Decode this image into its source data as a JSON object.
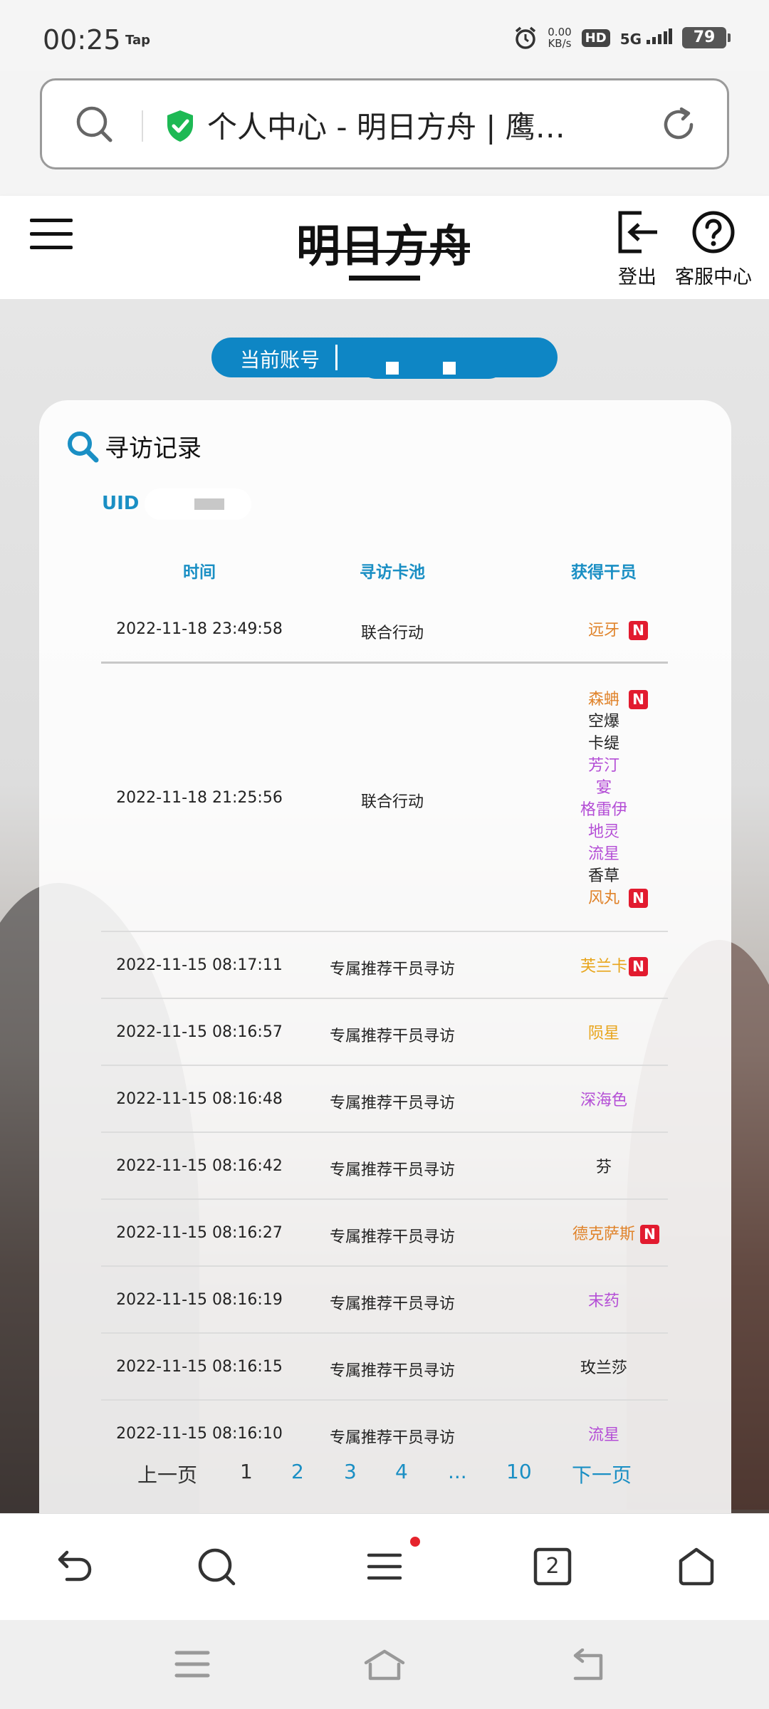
{
  "status_bar": {
    "time": "00:25",
    "app_indicator": "Tap",
    "net_speed_value": "0.00",
    "net_speed_unit": "KB/s",
    "hd": "HD",
    "signal": "5G",
    "battery": "79"
  },
  "address_bar": {
    "title": "个人中心 - 明日方舟 | 鹰…"
  },
  "header": {
    "logo_text": "明日方舟",
    "logout_label": "登出",
    "help_label": "客服中心"
  },
  "account": {
    "label": "当前账号"
  },
  "card": {
    "title": "寻访记录",
    "uid_label": "UID"
  },
  "table": {
    "headers": {
      "time": "时间",
      "pool": "寻访卡池",
      "operator": "获得干员"
    },
    "rows": [
      {
        "time": "2022-11-18 23:49:58",
        "pool": "联合行动",
        "ops": [
          {
            "name": "远牙",
            "color": "#e0832a",
            "new": true
          }
        ]
      },
      {
        "time": "2022-11-18 21:25:56",
        "pool": "联合行动",
        "ops": [
          {
            "name": "森蚺",
            "color": "#e0832a",
            "new": true
          },
          {
            "name": "空爆",
            "color": "#222222",
            "new": false
          },
          {
            "name": "卡缇",
            "color": "#222222",
            "new": false
          },
          {
            "name": "芳汀",
            "color": "#b44ed6",
            "new": false
          },
          {
            "name": "宴",
            "color": "#b44ed6",
            "new": false
          },
          {
            "name": "格雷伊",
            "color": "#b44ed6",
            "new": false
          },
          {
            "name": "地灵",
            "color": "#b44ed6",
            "new": false
          },
          {
            "name": "流星",
            "color": "#b44ed6",
            "new": false
          },
          {
            "name": "香草",
            "color": "#222222",
            "new": false
          },
          {
            "name": "风丸",
            "color": "#e0832a",
            "new": true
          }
        ]
      },
      {
        "time": "2022-11-15 08:17:11",
        "pool": "专属推荐干员寻访",
        "ops": [
          {
            "name": "芙兰卡",
            "color": "#e8a51c",
            "new": true
          }
        ]
      },
      {
        "time": "2022-11-15 08:16:57",
        "pool": "专属推荐干员寻访",
        "ops": [
          {
            "name": "陨星",
            "color": "#e8a51c",
            "new": false
          }
        ]
      },
      {
        "time": "2022-11-15 08:16:48",
        "pool": "专属推荐干员寻访",
        "ops": [
          {
            "name": "深海色",
            "color": "#b44ed6",
            "new": false
          }
        ]
      },
      {
        "time": "2022-11-15 08:16:42",
        "pool": "专属推荐干员寻访",
        "ops": [
          {
            "name": "芬",
            "color": "#222222",
            "new": false
          }
        ]
      },
      {
        "time": "2022-11-15 08:16:27",
        "pool": "专属推荐干员寻访",
        "ops": [
          {
            "name": "德克萨斯",
            "color": "#e0832a",
            "new": true
          }
        ]
      },
      {
        "time": "2022-11-15 08:16:19",
        "pool": "专属推荐干员寻访",
        "ops": [
          {
            "name": "末药",
            "color": "#b44ed6",
            "new": false
          }
        ]
      },
      {
        "time": "2022-11-15 08:16:15",
        "pool": "专属推荐干员寻访",
        "ops": [
          {
            "name": "玫兰莎",
            "color": "#222222",
            "new": false
          }
        ]
      },
      {
        "time": "2022-11-15 08:16:10",
        "pool": "专属推荐干员寻访",
        "ops": [
          {
            "name": "流星",
            "color": "#b44ed6",
            "new": false
          }
        ]
      }
    ],
    "new_badge": "N"
  },
  "pagination": {
    "prev": "上一页",
    "pages": [
      "1",
      "2",
      "3",
      "4",
      "...",
      "10"
    ],
    "current": "1",
    "next": "下一页"
  },
  "browser_bar": {
    "tab_count": "2"
  },
  "colors": {
    "accent": "#1a8fc4",
    "account_pill": "#0e86c5",
    "badge_new": "#e21b2f",
    "shield_green": "#1db954"
  }
}
